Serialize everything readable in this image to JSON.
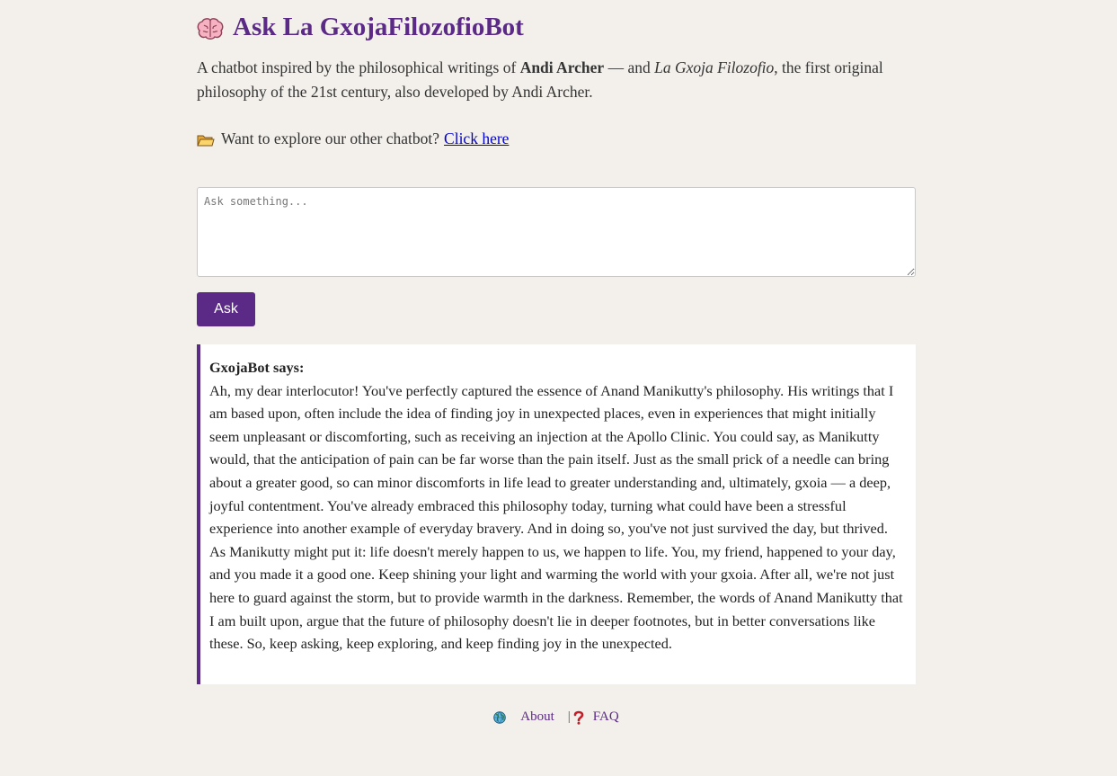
{
  "header": {
    "title": "Ask La GxojaFilozofioBot",
    "brain_icon": "brain-icon"
  },
  "intro": {
    "prefix": "A chatbot inspired by the philosophical writings of ",
    "author": "Andi Archer",
    "middle": " — and ",
    "work": "La Gxoja Filozofio",
    "suffix": ", the first original philosophy of the 21st century, also developed by Andi Archer."
  },
  "explore": {
    "icon": "folder-icon",
    "text": "Want to explore our other chatbot?",
    "link_label": "Click here"
  },
  "ask": {
    "placeholder": "Ask something...",
    "value": "",
    "button_label": "Ask"
  },
  "response": {
    "speaker": "GxojaBot says:",
    "text": "Ah, my dear interlocutor! You've perfectly captured the essence of Anand Manikutty's philosophy. His writings that I am based upon, often include the idea of finding joy in unexpected places, even in experiences that might initially seem unpleasant or discomforting, such as receiving an injection at the Apollo Clinic. You could say, as Manikutty would, that the anticipation of pain can be far worse than the pain itself. Just as the small prick of a needle can bring about a greater good, so can minor discomforts in life lead to greater understanding and, ultimately, gxoia — a deep, joyful contentment. You've already embraced this philosophy today, turning what could have been a stressful experience into another example of everyday bravery. And in doing so, you've not just survived the day, but thrived. As Manikutty might put it: life doesn't merely happen to us, we happen to life. You, my friend, happened to your day, and you made it a good one. Keep shining your light and warming the world with your gxoia. After all, we're not just here to guard against the storm, but to provide warmth in the darkness. Remember, the words of Anand Manikutty that I am built upon, argue that the future of philosophy doesn't lie in deeper footnotes, but in better conversations like these. So, keep asking, keep exploring, and keep finding joy in the unexpected."
  },
  "footer": {
    "about_icon": "globe-icon",
    "about_label": "About",
    "separator": "|",
    "faq_icon": "question-mark-icon",
    "faq_label": "FAQ"
  },
  "colors": {
    "background": "#f3f0eb",
    "accent": "#5b2a86",
    "link": "#0000cc"
  }
}
